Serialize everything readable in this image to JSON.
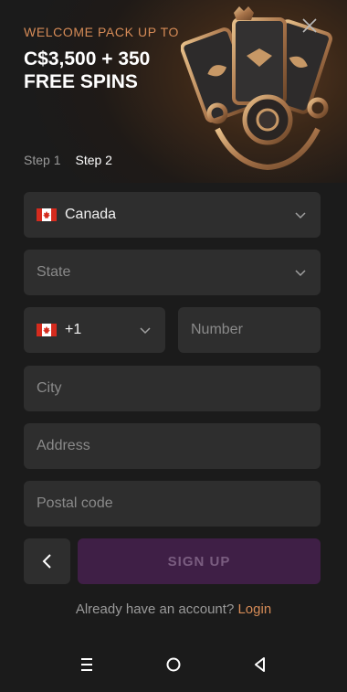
{
  "hero": {
    "welcome": "WELCOME PACK UP TO",
    "promo_line1": "C$3,500 + 350",
    "promo_line2": "FREE SPINS",
    "close_icon": "close-icon"
  },
  "steps": {
    "step1": "Step 1",
    "step2": "Step 2",
    "active": 2
  },
  "form": {
    "country": {
      "value": "Canada",
      "flag": "canada-flag-icon"
    },
    "state": {
      "placeholder": "State"
    },
    "phone_code": {
      "value": "+1",
      "flag": "canada-flag-icon"
    },
    "number": {
      "placeholder": "Number"
    },
    "city": {
      "placeholder": "City"
    },
    "address": {
      "placeholder": "Address"
    },
    "postal": {
      "placeholder": "Postal code"
    }
  },
  "actions": {
    "back_icon": "chevron-left-icon",
    "signup_label": "SIGN UP",
    "signup_color": "#3f1f46"
  },
  "login": {
    "prompt": "Already have an account?",
    "link": "Login"
  },
  "colors": {
    "accent": "#d68b57",
    "field_bg": "#2e2e2e",
    "page_bg": "#1b1b1b"
  },
  "system_nav": [
    "menu-icon",
    "home-circle-icon",
    "back-triangle-icon"
  ]
}
